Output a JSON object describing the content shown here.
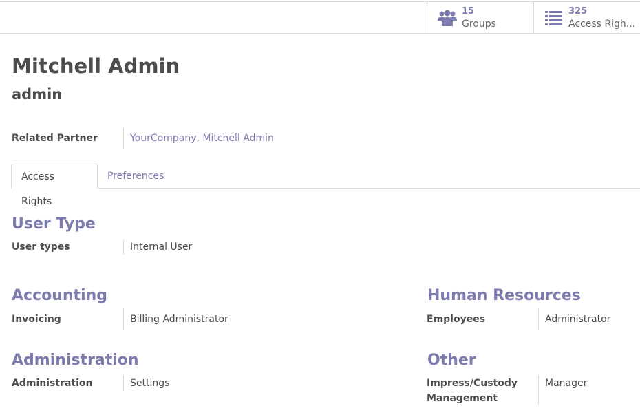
{
  "button_box": {
    "groups": {
      "count": "15",
      "label": "Groups",
      "icon": "users-icon"
    },
    "access_rights": {
      "count": "325",
      "label": "Access Righ...",
      "icon": "list-icon"
    }
  },
  "user": {
    "name": "Mitchell Admin",
    "login": "admin",
    "related_partner_label": "Related Partner",
    "related_partner_value": "YourCompany, Mitchell Admin"
  },
  "tabs": [
    {
      "label": "Access Rights",
      "active": true
    },
    {
      "label": "Preferences",
      "active": false
    }
  ],
  "sections": {
    "user_type": {
      "title": "User Type",
      "fields": [
        {
          "label": "User types",
          "value": "Internal User"
        }
      ]
    },
    "accounting": {
      "title": "Accounting",
      "fields": [
        {
          "label": "Invoicing",
          "value": "Billing Administrator"
        }
      ]
    },
    "human_resources": {
      "title": "Human Resources",
      "fields": [
        {
          "label": "Employees",
          "value": "Administrator"
        }
      ]
    },
    "administration": {
      "title": "Administration",
      "fields": [
        {
          "label": "Administration",
          "value": "Settings"
        }
      ]
    },
    "other": {
      "title": "Other",
      "fields": [
        {
          "label_line1": "Impress/Custody",
          "label_line2": "Management",
          "value": "Manager"
        }
      ]
    }
  },
  "colors": {
    "accent": "#7c7bad",
    "text": "#4c4c4c",
    "border": "#d9d9d9"
  }
}
